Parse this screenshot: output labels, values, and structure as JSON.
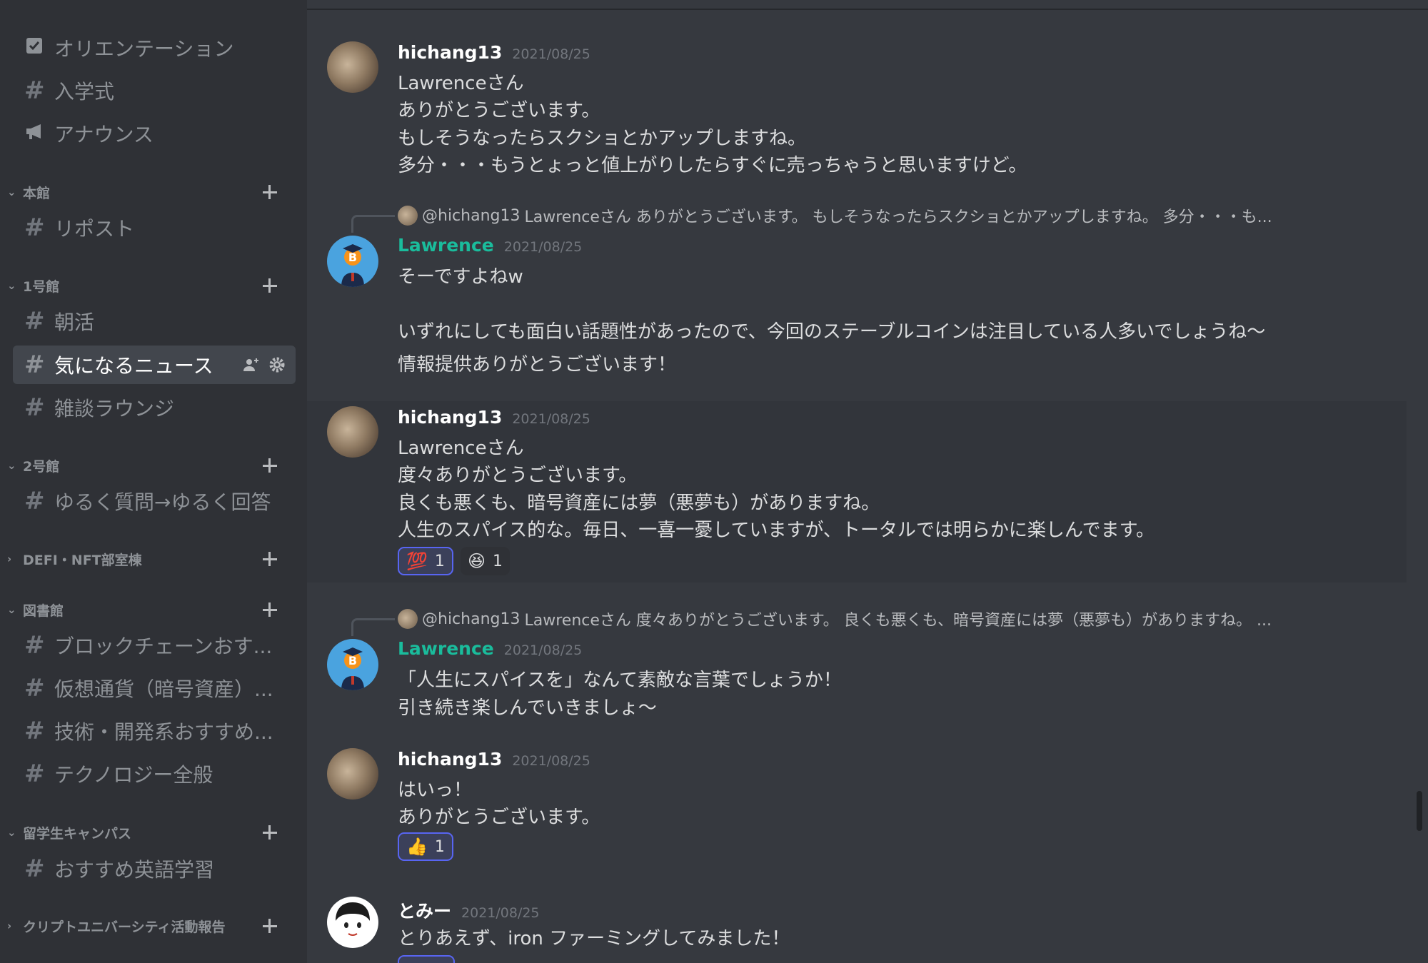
{
  "sidebar": {
    "channels_top": [
      {
        "label": "オリエンテーション",
        "icon": "checklist-icon"
      },
      {
        "label": "入学式",
        "icon": "hash-icon"
      },
      {
        "label": "アナウンス",
        "icon": "megaphone-icon"
      }
    ],
    "categories": [
      {
        "label": "本館",
        "collapsed": false,
        "channels": [
          "リポスト"
        ]
      },
      {
        "label": "1号館",
        "collapsed": false,
        "channels": [
          "朝活",
          "気になるニュース",
          "雑談ラウンジ"
        ]
      },
      {
        "label": "2号館",
        "collapsed": false,
        "channels": [
          "ゆるく質問→ゆるく回答"
        ]
      },
      {
        "label": "DEFI・NFT部室棟",
        "collapsed": true,
        "channels": []
      },
      {
        "label": "図書館",
        "collapsed": false,
        "channels": [
          "ブロックチェーンおす...",
          "仮想通貨（暗号資産）...",
          "技術・開発系おすすめ...",
          "テクノロジー全般"
        ]
      },
      {
        "label": "留学生キャンパス",
        "collapsed": false,
        "channels": [
          "おすすめ英語学習"
        ]
      },
      {
        "label": "クリプトユニバーシティ活動報告",
        "collapsed": true,
        "channels": []
      }
    ],
    "active_channel": "気になるニュース"
  },
  "messages": [
    {
      "author": "hichang13",
      "date": "2021/08/25",
      "lines": [
        "Lawrenceさん",
        "ありがとうございます。",
        "もしそうなったらスクショとかアップしますね。",
        "多分・・・もうとょっと値上がりしたらすぐに売っちゃうと思いますけど。"
      ]
    },
    {
      "reply_to": {
        "name": "@hichang13",
        "text": "Lawrenceさん ありがとうございます。 もしそうなったらスクショとかアップしますね。 多分・・・も..."
      },
      "author": "Lawrence",
      "date": "2021/08/25",
      "lines": [
        "そーですよねw",
        "",
        "いずれにしても面白い話題性があったので、今回のステーブルコインは注目している人多いでしょうね〜",
        "情報提供ありがとうございます！"
      ]
    },
    {
      "author": "hichang13",
      "date": "2021/08/25",
      "lines": [
        "Lawrenceさん",
        "度々ありがとうございます。",
        "良くも悪くも、暗号資産には夢（悪夢も）がありますね。",
        "人生のスパイス的な。毎日、一喜一憂していますが、トータルでは明らかに楽しんでます。"
      ],
      "reactions": [
        {
          "emoji": "💯",
          "count": "1"
        },
        {
          "emoji": "😆",
          "count": "1"
        }
      ]
    },
    {
      "reply_to": {
        "name": "@hichang13",
        "text": "Lawrenceさん 度々ありがとうございます。 良くも悪くも、暗号資産には夢（悪夢も）がありますね。 ..."
      },
      "author": "Lawrence",
      "date": "2021/08/25",
      "lines": [
        "「人生にスパイスを」なんて素敵な言葉でしょうか！",
        "引き続き楽しんでいきましょ〜"
      ]
    },
    {
      "author": "hichang13",
      "date": "2021/08/25",
      "lines": [
        "はいっ！",
        "ありがとうございます。"
      ],
      "reactions": [
        {
          "emoji": "👍",
          "count": "1"
        }
      ]
    },
    {
      "author": "とみー",
      "date": "2021/08/25",
      "lines": [
        "とりあえず、iron ファーミングしてみました！"
      ]
    }
  ],
  "colors": {
    "accent": "#5865f2",
    "lawrence_name": "#1abc9c",
    "background": "#36393f",
    "sidebar": "#2f3136"
  }
}
